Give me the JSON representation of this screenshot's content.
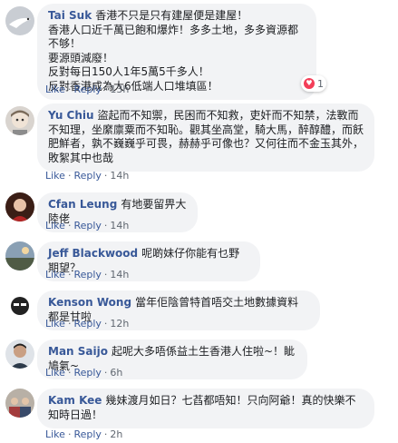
{
  "actions": {
    "like": "Like",
    "reply": "Reply",
    "sep": "·"
  },
  "comments": [
    {
      "name": "Tai Suk",
      "text": "香港不只是只有建屋便是建屋！\n香港人口近千萬已飽和爆炸！多多土地，多多資源都不够！\n要源頭減廢！\n反對每日150人1年5萬5千多人！\n反對香港成為大6低端人口堆填區！",
      "time": "13h",
      "reaction_count": "1",
      "avatar": "bird-avatar"
    },
    {
      "name": "Yu Chiu",
      "text": "盜起而不知禦，民困而不知救，吏奸而不知禁，法斁而不知理，坐縻廪粟而不知恥。觀其坐高堂，騎大馬，醉醇醴，而飫肥鮮者，孰不巍巍乎可畏，赫赫乎可像也？又何往而不金玉其外，敗絮其中也哉",
      "time": "14h",
      "avatar": "doll-avatar"
    },
    {
      "name": "Cfan Leung",
      "text": "有地要留畀大陸佬",
      "time": "14h",
      "avatar": "woman-avatar"
    },
    {
      "name": "Jeff Blackwood",
      "text": "呢啲妹仔你能有乜野期望？",
      "time": "14h",
      "avatar": "landscape-avatar"
    },
    {
      "name": "Kenson Wong",
      "text": "當年佢陰曾特首唔交土地數據資料都是甘啦",
      "time": "12h",
      "avatar": "cartoon-avatar"
    },
    {
      "name": "Man Saijo",
      "text": "起呢大多唔係益土生香港人住啦~！眦鳩氣~",
      "time": "6h",
      "avatar": "man-avatar"
    },
    {
      "name": "Kam Kee",
      "text": "幾妹渡月如日？七萏都唔知！只向阿爺！真的快樂不知時日過！",
      "time": "2h",
      "avatar": "group-avatar"
    }
  ]
}
